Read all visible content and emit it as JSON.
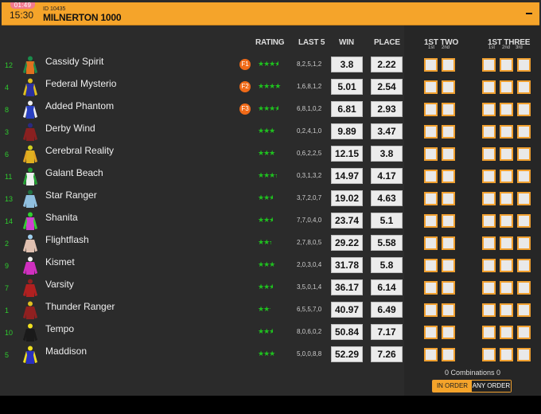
{
  "header": {
    "countdown": "01:49",
    "time": "15:30",
    "race_id": "ID 10435",
    "race_name": "MILNERTON 1000",
    "minimize_icon": "minus-icon"
  },
  "columns": {
    "rating": "RATING",
    "last5": "LAST 5",
    "win": "WIN",
    "place": "PLACE",
    "first_two": "1ST TWO",
    "first_three": "1ST THREE",
    "sub_1st": "1st",
    "sub_2nd": "2nd",
    "sub_3rd": "3rd"
  },
  "colors": {
    "accent": "#f5a42a",
    "favorite_badge": "#f06a18",
    "number_green": "#2ecc2e",
    "star_green": "#1fc21f",
    "countdown_pink": "#f07a8f"
  },
  "runners": [
    {
      "number": "12",
      "name": "Cassidy Spirit",
      "fav": "F1",
      "rating": 3.5,
      "last5": "8,2,5,1,2",
      "win": "3.8",
      "place": "2.22",
      "silk": [
        "#e07020",
        "#1a8a4a",
        "#1a8a4a"
      ]
    },
    {
      "number": "4",
      "name": "Federal Mysterio",
      "fav": "F2",
      "rating": 4,
      "last5": "1,6,8,1,2",
      "win": "5.01",
      "place": "2.54",
      "silk": [
        "#2a30a0",
        "#e0c020",
        "#e0c020"
      ]
    },
    {
      "number": "8",
      "name": "Added Phantom",
      "fav": "F3",
      "rating": 3.5,
      "last5": "6,8,1,0,2",
      "win": "6.81",
      "place": "2.93",
      "silk": [
        "#2a40c0",
        "#f0f0f0",
        "#f0f0f0"
      ]
    },
    {
      "number": "3",
      "name": "Derby Wind",
      "fav": "",
      "rating": 3,
      "last5": "0,2,4,1,0",
      "win": "9.89",
      "place": "3.47",
      "silk": [
        "#8a2020",
        "#2a2a80",
        "#8a2020"
      ]
    },
    {
      "number": "6",
      "name": "Cerebral Reality",
      "fav": "",
      "rating": 3,
      "last5": "0,6,2,2,5",
      "win": "12.15",
      "place": "3.8",
      "silk": [
        "#e0b020",
        "#d0d020",
        "#e0a020"
      ]
    },
    {
      "number": "11",
      "name": "Galant Beach",
      "fav": "",
      "rating": 3.3,
      "last5": "0,3,1,3,2",
      "win": "14.97",
      "place": "4.17",
      "silk": [
        "#f0f0f0",
        "#20a030",
        "#20a030"
      ]
    },
    {
      "number": "13",
      "name": "Star Ranger",
      "fav": "",
      "rating": 2.5,
      "last5": "3,7,2,0,7",
      "win": "19.02",
      "place": "4.63",
      "silk": [
        "#90c0e0",
        "#207040",
        "#90c0e0"
      ]
    },
    {
      "number": "14",
      "name": "Shanita",
      "fav": "",
      "rating": 2.5,
      "last5": "7,7,0,4,0",
      "win": "23.74",
      "place": "5.1",
      "silk": [
        "#d040d0",
        "#30d030",
        "#30d030"
      ]
    },
    {
      "number": "2",
      "name": "Flightflash",
      "fav": "",
      "rating": 2.3,
      "last5": "2,7,8,0,5",
      "win": "29.22",
      "place": "5.58",
      "silk": [
        "#e0c0b0",
        "#a0d0f0",
        "#e0c0b0"
      ]
    },
    {
      "number": "9",
      "name": "Kismet",
      "fav": "",
      "rating": 3,
      "last5": "2,0,3,0,4",
      "win": "31.78",
      "place": "5.8",
      "silk": [
        "#d030c0",
        "#f0f0f0",
        "#d030c0"
      ]
    },
    {
      "number": "7",
      "name": "Varsity",
      "fav": "",
      "rating": 2.5,
      "last5": "3,5,0,1,4",
      "win": "36.17",
      "place": "6.14",
      "silk": [
        "#b02020",
        "#902020",
        "#b02020"
      ]
    },
    {
      "number": "1",
      "name": "Thunder Ranger",
      "fav": "",
      "rating": 2.2,
      "last5": "6,5,5,7,0",
      "win": "40.97",
      "place": "6.49",
      "silk": [
        "#902020",
        "#e0c020",
        "#902020"
      ]
    },
    {
      "number": "10",
      "name": "Tempo",
      "fav": "",
      "rating": 2.5,
      "last5": "8,0,6,0,2",
      "win": "50.84",
      "place": "7.17",
      "silk": [
        "#1a1a1a",
        "#f0e020",
        "#1a1a1a"
      ]
    },
    {
      "number": "5",
      "name": "Maddison",
      "fav": "",
      "rating": 3,
      "last5": "5,0,0,8,8",
      "win": "52.29",
      "place": "7.26",
      "silk": [
        "#2a30c0",
        "#f0e020",
        "#f0e020"
      ]
    }
  ],
  "footer": {
    "combinations": "0 Combinations 0",
    "in_order": "IN ORDER",
    "any_order": "ANY ORDER"
  }
}
